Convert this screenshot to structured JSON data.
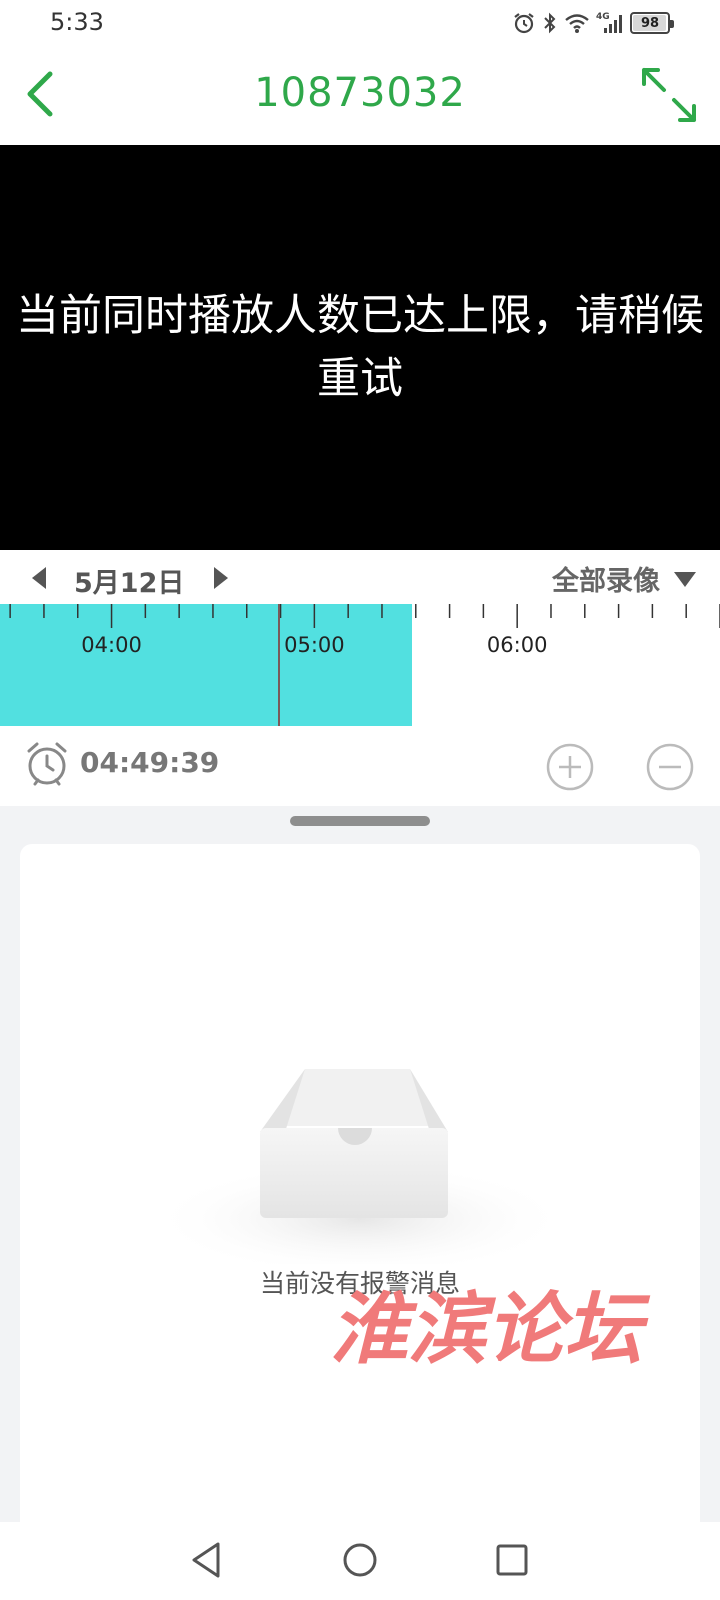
{
  "status_bar": {
    "time": "5:33",
    "network_label": "4G",
    "battery_level": "98",
    "battery_fraction": 0.98
  },
  "header": {
    "title": "10873032",
    "accent_color": "#2fa84a"
  },
  "video": {
    "message": "当前同时播放人数已达上限，请稍候重试"
  },
  "date_bar": {
    "date": "5月12日",
    "filter_label": "全部录像"
  },
  "timeline": {
    "hour_labels": [
      "04:00",
      "05:00",
      "06:00"
    ],
    "recorded_color": "#52e0e0",
    "view_start_hours": 3.45,
    "hours_per_view": 3.55,
    "recorded_end_hours": 5.48,
    "cursor_hours": 4.8275
  },
  "time_row": {
    "current_time": "04:49:39"
  },
  "alerts": {
    "empty_text": "当前没有报警消息"
  },
  "watermark": {
    "text": "淮滨论坛",
    "color": "#f07a7a"
  },
  "icons": {
    "header": [
      "back-arrow-icon",
      "fullscreen-icon"
    ],
    "date_bar": [
      "triangle-left-icon",
      "triangle-right-icon",
      "triangle-down-icon"
    ],
    "time_row": [
      "alarm-clock-icon",
      "plus-circle-icon",
      "minus-circle-icon"
    ],
    "nav": [
      "triangle-back-icon",
      "circle-home-icon",
      "square-recent-icon"
    ]
  }
}
